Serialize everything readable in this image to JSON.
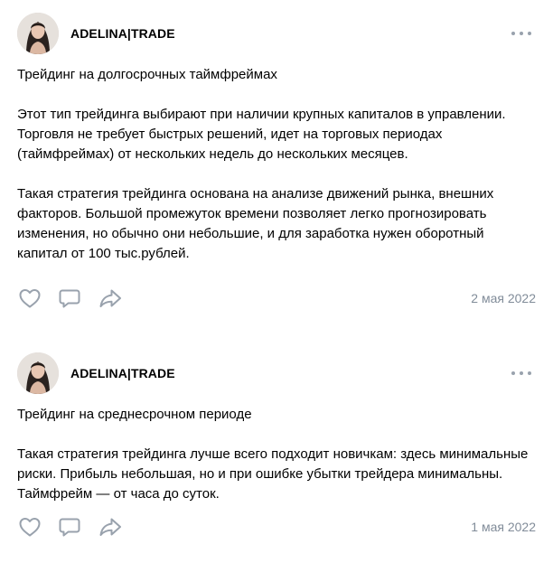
{
  "posts": [
    {
      "author": "ADELINA|TRADE",
      "title": "Трейдинг на долгосрочных таймфреймах",
      "paragraphs": [
        "Этот тип трейдинга выбирают при наличии крупных капиталов в управлении. Торговля не требует быстрых решений, идет на торговых периодах (таймфреймах) от нескольких недель до нескольких месяцев.",
        "Такая стратегия трейдинга основана на анализе движений рынка, внешних факторов. Большой промежуток времени позволяет легко прогнозировать изменения, но обычно они небольшие, и для заработка нужен оборотный капитал от 100 тыс.рублей."
      ],
      "date": "2 мая 2022"
    },
    {
      "author": "ADELINA|TRADE",
      "title": "Трейдинг на среднесрочном периоде",
      "paragraphs": [
        "Такая стратегия трейдинга лучше всего подходит новичкам: здесь минимальные риски. Прибыль небольшая, но и при ошибке убытки трейдера минимальны. Таймфрейм — от часа до суток."
      ],
      "date": "1 мая 2022"
    }
  ],
  "icons": {
    "like": "heart-icon",
    "comment": "comment-icon",
    "share": "share-icon",
    "more": "more-icon"
  },
  "colors": {
    "icon": "#99a2ad",
    "date": "#818c99",
    "text": "#000000"
  }
}
